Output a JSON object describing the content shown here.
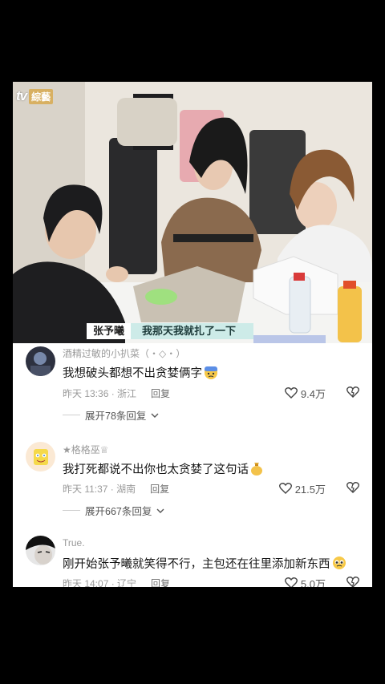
{
  "video": {
    "logo_tv": "tv",
    "logo_badge": "綜藝",
    "caption_name": "张予曦",
    "caption_text": "我那天我就扎了一下"
  },
  "comments": [
    {
      "username": "酒精过敏的小扒菜（・◇・）",
      "text": "我想破头都想不出贪婪俩字",
      "emoji": "sweat-blue-face-icon",
      "time": "昨天 13:36 · 浙江",
      "reply_label": "回复",
      "likes": "9.4万",
      "expand": "展开78条回复"
    },
    {
      "username": "★格格巫♕",
      "text": "我打死都说不出你也太贪婪了这句话",
      "emoji": "money-bag-icon",
      "time": "昨天 11:37 · 湖南",
      "reply_label": "回复",
      "likes": "21.5万",
      "expand": "展开667条回复"
    },
    {
      "username": "True.",
      "text": "刚开始张予曦就笑得不行，主包还在往里添加新东西",
      "emoji": "pleading-face-icon",
      "time": "昨天 14:07 · 辽宁",
      "reply_label": "回复",
      "likes": "5.0万"
    }
  ],
  "colors": {
    "background": "#000000",
    "card": "#ffffff",
    "caption_accent": "#cdebe8",
    "meta_gray": "#9a9a9a"
  }
}
